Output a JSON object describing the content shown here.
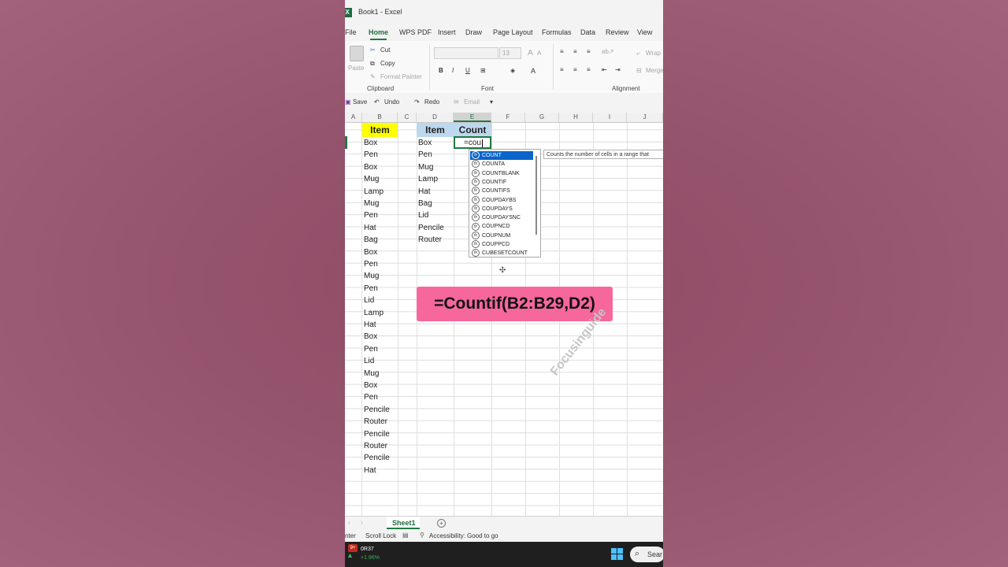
{
  "window": {
    "title": "Book1 - Excel",
    "app_icon": "excel-icon"
  },
  "tabs": [
    "File",
    "Home",
    "WPS PDF",
    "Insert",
    "Draw",
    "Page Layout",
    "Formulas",
    "Data",
    "Review",
    "View"
  ],
  "active_tab": "Home",
  "ribbon": {
    "paste": "Paste",
    "cut": "Cut",
    "copy": "Copy",
    "format_painter": "Format Painter",
    "font_size": "13",
    "bold": "B",
    "italic": "I",
    "underline": "U",
    "wrap": "Wrap",
    "merge": "Merge",
    "groups": {
      "clipboard": "Clipboard",
      "font": "Font",
      "alignment": "Alignment"
    }
  },
  "qat": {
    "save": "Save",
    "undo": "Undo",
    "redo": "Redo",
    "email": "Email"
  },
  "columns": [
    "A",
    "B",
    "C",
    "D",
    "E",
    "F",
    "G",
    "H",
    "I",
    "J"
  ],
  "selected_column": "E",
  "headers": {
    "b": "Item",
    "d": "Item",
    "e": "Count"
  },
  "column_b": [
    "Box",
    "Pen",
    "Box",
    "Mug",
    "Lamp",
    "Mug",
    "Pen",
    "Hat",
    "Bag",
    "Box",
    "Pen",
    "Mug",
    "Pen",
    "Lid",
    "Lamp",
    "Hat",
    "Box",
    "Pen",
    "Lid",
    "Mug",
    "Box",
    "Pen",
    "Pencile",
    "Router",
    "Pencile",
    "Router",
    "Pencile",
    "Hat"
  ],
  "column_d": [
    "Box",
    "Pen",
    "Mug",
    "Lamp",
    "Hat",
    "Bag",
    "Lid",
    "Pencile",
    "Router"
  ],
  "active_cell_text": "=cou",
  "autocomplete": [
    "COUNT",
    "COUNTA",
    "COUNTBLANK",
    "COUNTIF",
    "COUNTIFS",
    "COUPDAYBS",
    "COUPDAYS",
    "COUPDAYSNC",
    "COUPNCD",
    "COUPNUM",
    "COUPPCD",
    "CUBESETCOUNT"
  ],
  "tooltip": "Counts the number of cells in a range that",
  "formula_banner": "=Countif(B2:B29,D2)",
  "watermark": "Focusinguide",
  "sheet_tab": "Sheet1",
  "status": {
    "left": "nter",
    "scroll_lock": "Scroll Lock",
    "accessibility": "Accessibility: Good to go"
  },
  "taskbar": {
    "stock_badge": "9+",
    "stock_name": "0R37",
    "stock_change": "+1.96%",
    "search": "Sear"
  },
  "colors": {
    "item_header_b": "#ffff00",
    "item_header_d": "#bdd7ee",
    "excel_green": "#1f7a43",
    "banner": "#f6679c"
  }
}
